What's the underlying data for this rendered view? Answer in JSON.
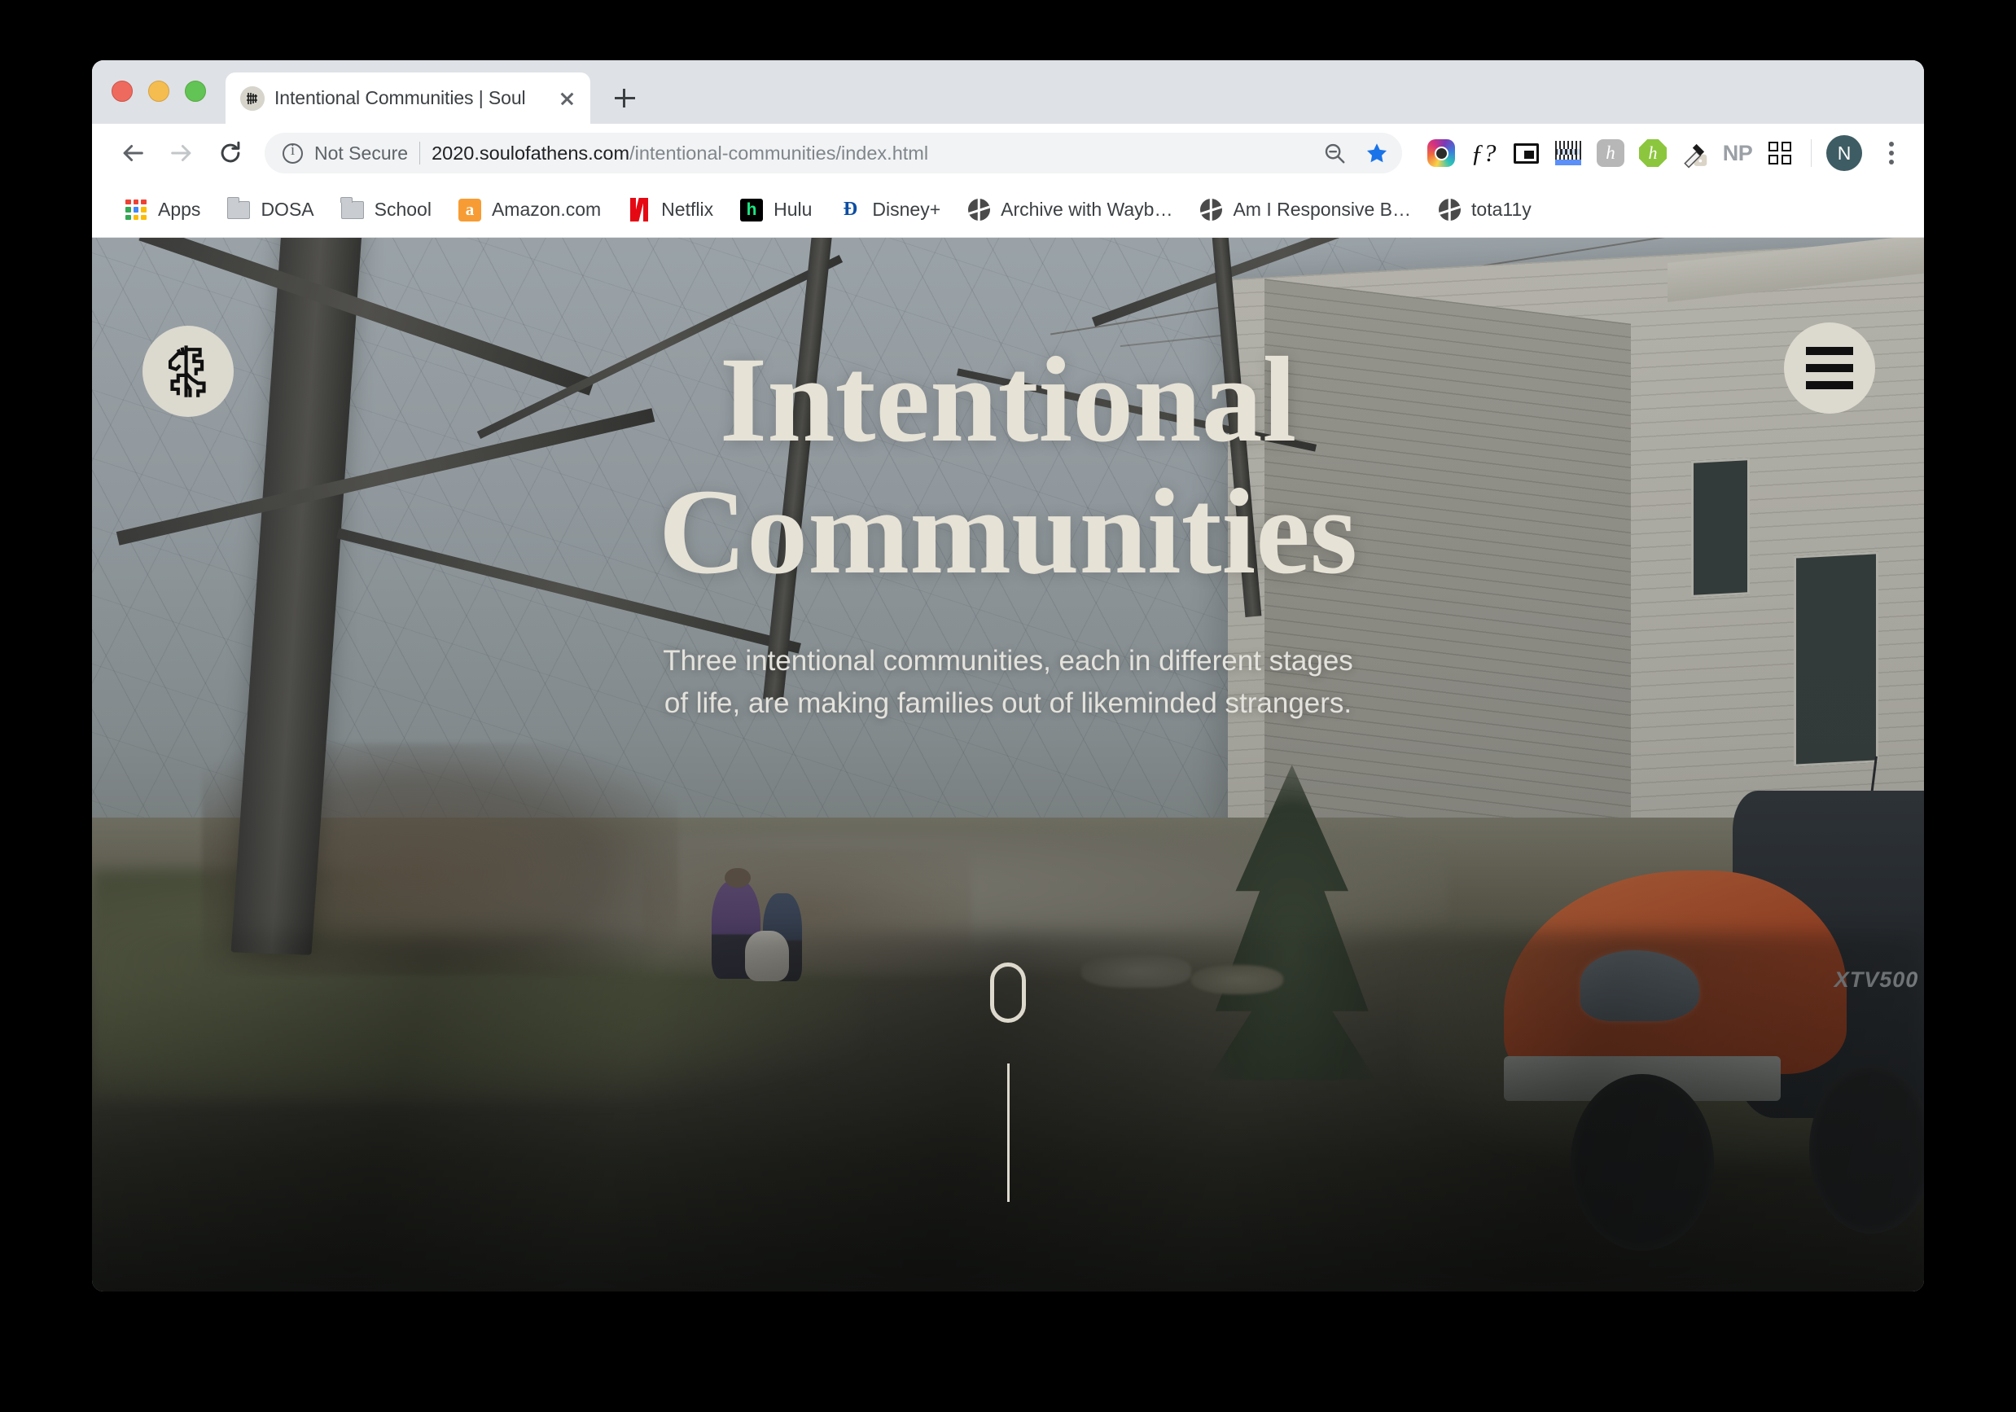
{
  "browser": {
    "tab": {
      "title": "Intentional Communities | Soul",
      "favicon_name": "site-logo-favicon",
      "close_label": "Close tab"
    },
    "new_tab_label": "New Tab",
    "nav": {
      "back_label": "Back",
      "forward_label": "Forward",
      "reload_label": "Reload"
    },
    "omnibox": {
      "security_label": "Not Secure",
      "url_domain": "2020.soulofathens.com",
      "url_path": "/intentional-communities/index.html",
      "full_url": "2020.soulofathens.com/intentional-communities/index.html",
      "zoom_icon": "zoom-out-icon",
      "bookmark_icon": "star-icon"
    },
    "extensions": [
      {
        "name": "instagram-extension",
        "label": ""
      },
      {
        "name": "font-finder-extension",
        "label": "ƒ?"
      },
      {
        "name": "picture-in-picture-extension",
        "label": ""
      },
      {
        "name": "barcode-extension",
        "label": ""
      },
      {
        "name": "hypothesis-extension",
        "label": "h"
      },
      {
        "name": "honey-extension",
        "label": "h"
      },
      {
        "name": "color-picker-extension",
        "label": ""
      },
      {
        "name": "np-extension",
        "label": "NP"
      },
      {
        "name": "extensions-grid-button",
        "label": ""
      }
    ],
    "profile": {
      "initial": "N"
    },
    "menu_label": "Customize and control Google Chrome",
    "bookmarks": [
      {
        "label": "Apps",
        "icon": "apps-grid-icon"
      },
      {
        "label": "DOSA",
        "icon": "folder-icon"
      },
      {
        "label": "School",
        "icon": "folder-icon"
      },
      {
        "label": "Amazon.com",
        "icon": "amazon-icon"
      },
      {
        "label": "Netflix",
        "icon": "netflix-icon"
      },
      {
        "label": "Hulu",
        "icon": "hulu-icon"
      },
      {
        "label": "Disney+",
        "icon": "disney-plus-icon"
      },
      {
        "label": "Archive with Wayb…",
        "icon": "globe-icon"
      },
      {
        "label": "Am I Responsive B…",
        "icon": "globe-icon"
      },
      {
        "label": "tota11y",
        "icon": "globe-icon"
      }
    ]
  },
  "page": {
    "logo_alt": "Soul of Athens logo",
    "menu_button_label": "Open menu",
    "hero": {
      "title_line_1": "Intentional",
      "title_line_2": "Communities",
      "subtitle": "Three intentional communities, each in different stages of life, are making families out of likeminded strangers.",
      "scroll_hint": "Scroll down"
    },
    "colors": {
      "cream": "#dcd9cf",
      "title_text": "#e6e2d6",
      "subtitle_text": "#e4e2dc"
    }
  }
}
